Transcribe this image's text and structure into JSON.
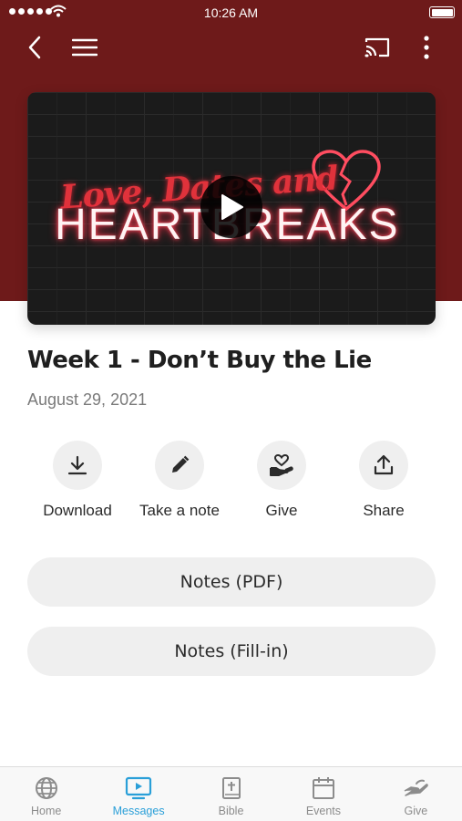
{
  "status_bar": {
    "time": "10:26 AM"
  },
  "colors": {
    "header_bg": "#6e1a1a",
    "accent": "#2a9fd8",
    "inactive": "#8c8c8c"
  },
  "video": {
    "art_script": "Love, Dates and",
    "art_title": "HEARTBREAKS"
  },
  "message": {
    "title": "Week 1 - Don’t Buy the Lie",
    "date": "August 29, 2021"
  },
  "actions": [
    {
      "label": "Download",
      "icon": "download-icon"
    },
    {
      "label": "Take a note",
      "icon": "pencil-icon"
    },
    {
      "label": "Give",
      "icon": "give-heart-hand-icon"
    },
    {
      "label": "Share",
      "icon": "share-icon"
    }
  ],
  "buttons": {
    "notes_pdf": "Notes (PDF)",
    "notes_fillin": "Notes (Fill-in)"
  },
  "tabs": [
    {
      "label": "Home",
      "icon": "globe-icon",
      "active": false
    },
    {
      "label": "Messages",
      "icon": "tv-play-icon",
      "active": true
    },
    {
      "label": "Bible",
      "icon": "bible-icon",
      "active": false
    },
    {
      "label": "Events",
      "icon": "calendar-icon",
      "active": false
    },
    {
      "label": "Give",
      "icon": "give-hand-icon",
      "active": false
    }
  ]
}
